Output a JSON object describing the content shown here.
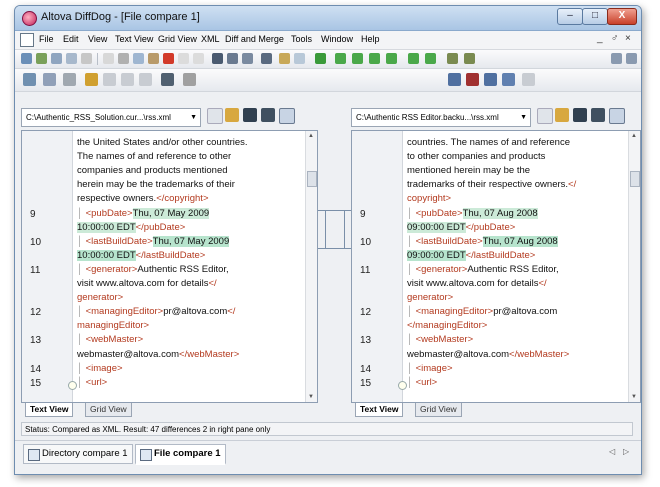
{
  "window": {
    "title": "Altova DiffDog - [File compare 1]"
  },
  "controls": {
    "minimize": "–",
    "maximize": "□",
    "close": "X",
    "mdi_minimize": "_",
    "mdi_restore": "♂",
    "mdi_close": "×"
  },
  "menu": [
    "File",
    "Edit",
    "View",
    "Text View",
    "Grid View",
    "XML",
    "Diff and Merge",
    "Tools",
    "Window",
    "Help"
  ],
  "left": {
    "path": "C:\\Authentic_RSS_Solution.cur...\\rss.xml",
    "lines": [
      {
        "num": "",
        "text": "the United States and/or other countries."
      },
      {
        "num": "",
        "text": "The names of and reference to other"
      },
      {
        "num": "",
        "text": "companies and products mentioned"
      },
      {
        "num": "",
        "text": "herein may be the trademarks of their"
      },
      {
        "num": "",
        "text": "respective owners.",
        "tag": "</copyright>"
      },
      {
        "num": "9",
        "tag_pre": "<pubDate>",
        "text": "Thu, 07 May 2009",
        "hl": "hl2"
      },
      {
        "num": "",
        "text": "10:00:00 EDT",
        "tag": "</pubDate>",
        "hl": "hl2"
      },
      {
        "num": "10",
        "tag_pre": "<lastBuildDate>",
        "text": "Thu, 07 May 2009",
        "hl": "hl"
      },
      {
        "num": "",
        "text": "10:00:00 EDT",
        "tag": "</lastBuildDate>",
        "hl": "hl"
      },
      {
        "num": "11",
        "tag_pre": "<generator>",
        "text": "Authentic RSS Editor,"
      },
      {
        "num": "",
        "text": "visit www.altova.com for details",
        "tag": "</"
      },
      {
        "num": "",
        "text": "",
        "tag": "generator>"
      },
      {
        "num": "12",
        "tag_pre": "<managingEditor>",
        "text": "pr@altova.com",
        "tag": "</"
      },
      {
        "num": "",
        "text": "",
        "tag": "managingEditor>"
      },
      {
        "num": "13",
        "tag_pre": "<webMaster>",
        "text": ""
      },
      {
        "num": "",
        "text": "webmaster@altova.com",
        "tag": "</webMaster>"
      },
      {
        "num": "14",
        "tag_pre": "<image>",
        "text": ""
      },
      {
        "num": "15",
        "tag_pre": "<url>",
        "text": ""
      }
    ],
    "tabs": [
      "Text View",
      "Grid View"
    ]
  },
  "right": {
    "path": "C:\\Authentic RSS Editor.backu...\\rss.xml",
    "lines": [
      {
        "num": "",
        "text": "countries. The names of and reference"
      },
      {
        "num": "",
        "text": "to other companies and products"
      },
      {
        "num": "",
        "text": "mentioned herein may be the"
      },
      {
        "num": "",
        "text": "trademarks of their respective owners.",
        "tag": "</"
      },
      {
        "num": "",
        "text": "",
        "tag": "copyright>"
      },
      {
        "num": "9",
        "tag_pre": "<pubDate>",
        "text": "Thu, 07 Aug 2008",
        "hl": "hl2"
      },
      {
        "num": "",
        "text": "09:00:00 EDT",
        "tag": "</pubDate>",
        "hl": "hl2"
      },
      {
        "num": "10",
        "tag_pre": "<lastBuildDate>",
        "text": "Thu, 07 Aug 2008",
        "hl": "hl"
      },
      {
        "num": "",
        "text": "09:00:00 EDT",
        "tag": "</lastBuildDate>",
        "hl": "hl"
      },
      {
        "num": "11",
        "tag_pre": "<generator>",
        "text": "Authentic RSS Editor,"
      },
      {
        "num": "",
        "text": "visit www.altova.com for details",
        "tag": "</"
      },
      {
        "num": "",
        "text": "",
        "tag": "generator>"
      },
      {
        "num": "12",
        "tag_pre": "<managingEditor>",
        "text": "pr@altova.com"
      },
      {
        "num": "",
        "text": "",
        "tag": "</managingEditor>"
      },
      {
        "num": "13",
        "tag_pre": "<webMaster>",
        "text": ""
      },
      {
        "num": "",
        "text": "webmaster@altova.com",
        "tag": "</webMaster>"
      },
      {
        "num": "14",
        "tag_pre": "<image>",
        "text": ""
      },
      {
        "num": "15",
        "tag_pre": "<url>",
        "text": ""
      }
    ],
    "tabs": [
      "Text View",
      "Grid View"
    ]
  },
  "status": "Status: Compared as XML. Result: 47 differences 2 in right pane only",
  "bottom_tabs": [
    "Directory compare 1",
    "File compare 1"
  ],
  "bottom_nav": [
    "◁",
    "▷"
  ],
  "colors": {
    "tag": "#b33a1f",
    "diff_highlight": "#b7e4cd"
  }
}
